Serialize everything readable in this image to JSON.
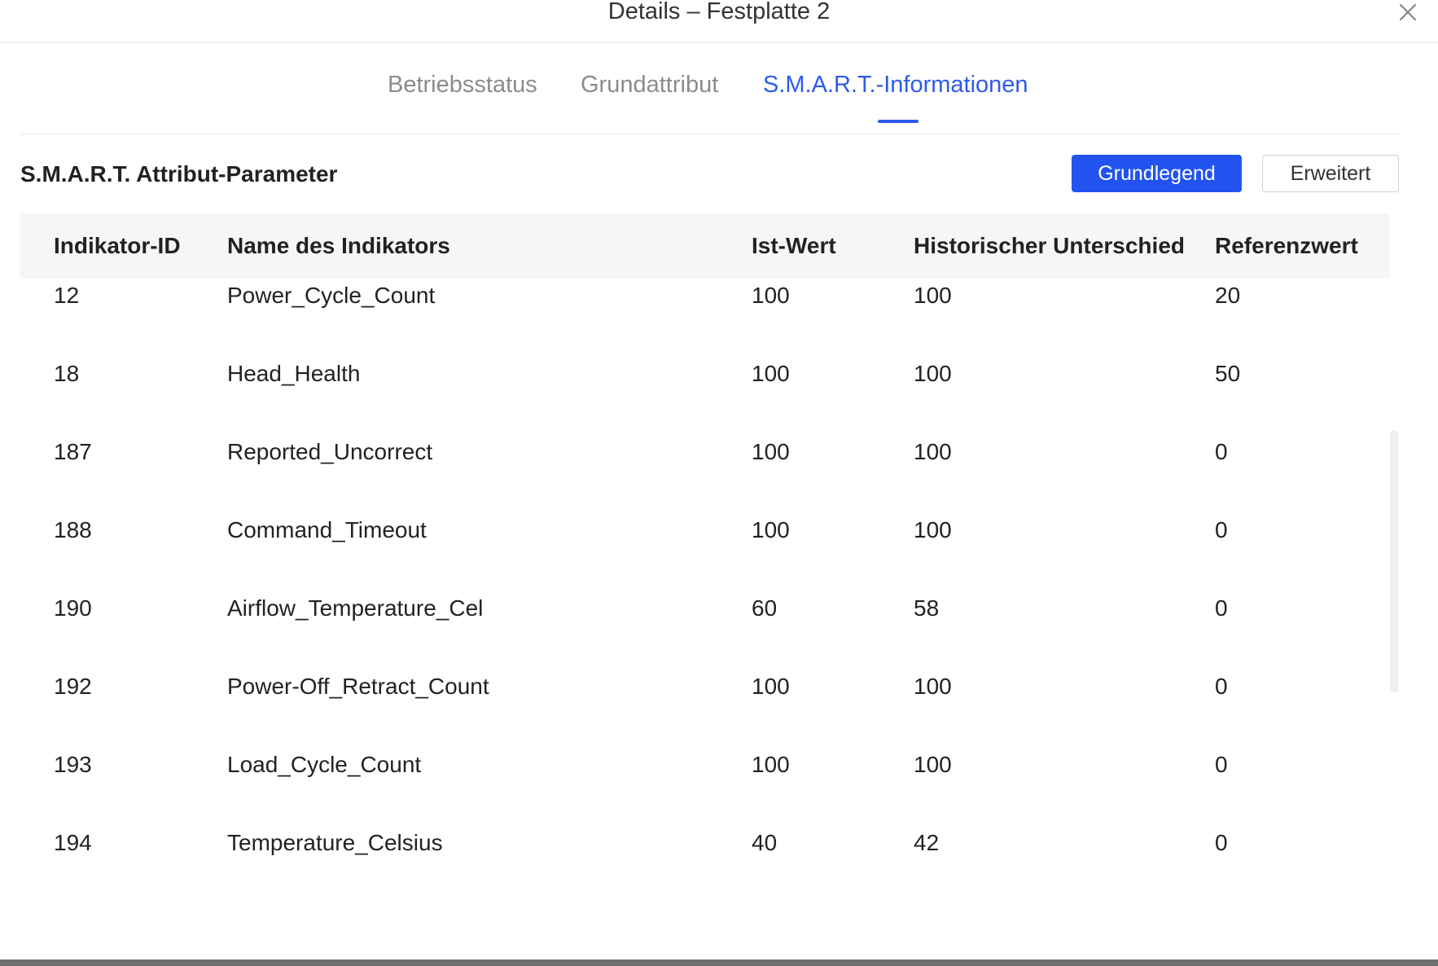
{
  "dialog": {
    "title": "Details – Festplatte 2"
  },
  "tabs": [
    {
      "label": "Betriebsstatus",
      "active": false
    },
    {
      "label": "Grundattribut",
      "active": false
    },
    {
      "label": "S.M.A.R.T.-Informationen",
      "active": true
    }
  ],
  "section": {
    "title": "S.M.A.R.T. Attribut-Parameter",
    "buttons": {
      "basic": "Grundlegend",
      "advanced": "Erweitert"
    }
  },
  "table": {
    "headers": [
      "Indikator-ID",
      "Name des Indikators",
      "Ist-Wert",
      "Historischer Unterschied",
      "Referenzwert"
    ],
    "rows": [
      {
        "id": "12",
        "name": "Power_Cycle_Count",
        "current": "100",
        "history": "100",
        "reference": "20"
      },
      {
        "id": "18",
        "name": "Head_Health",
        "current": "100",
        "history": "100",
        "reference": "50"
      },
      {
        "id": "187",
        "name": "Reported_Uncorrect",
        "current": "100",
        "history": "100",
        "reference": "0"
      },
      {
        "id": "188",
        "name": "Command_Timeout",
        "current": "100",
        "history": "100",
        "reference": "0"
      },
      {
        "id": "190",
        "name": "Airflow_Temperature_Cel",
        "current": "60",
        "history": "58",
        "reference": "0"
      },
      {
        "id": "192",
        "name": "Power-Off_Retract_Count",
        "current": "100",
        "history": "100",
        "reference": "0"
      },
      {
        "id": "193",
        "name": "Load_Cycle_Count",
        "current": "100",
        "history": "100",
        "reference": "0"
      },
      {
        "id": "194",
        "name": "Temperature_Celsius",
        "current": "40",
        "history": "42",
        "reference": "0"
      }
    ]
  },
  "colors": {
    "accent": "#2d5bea",
    "primary_button": "#2253ef"
  }
}
